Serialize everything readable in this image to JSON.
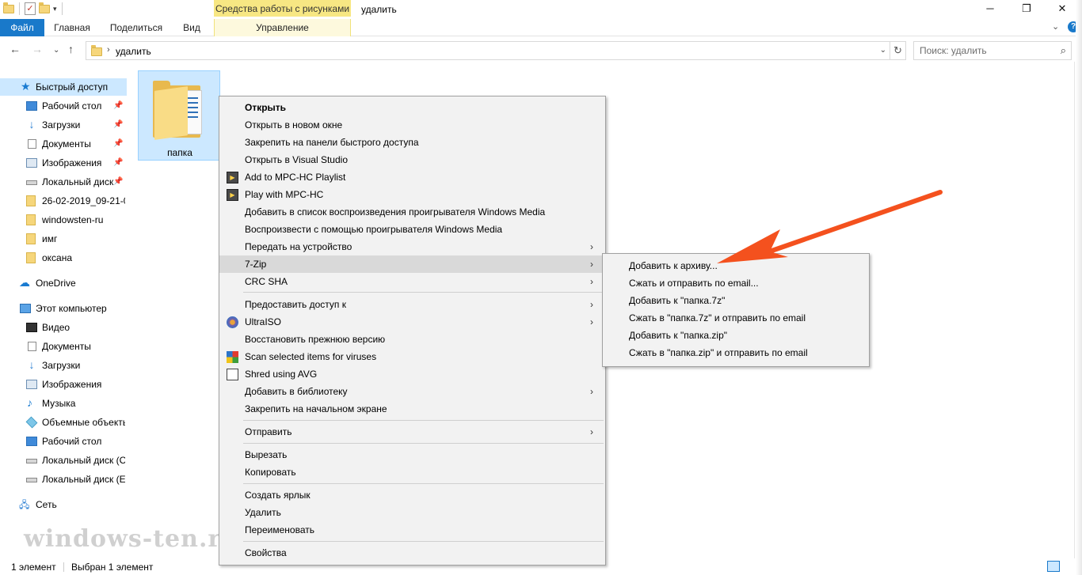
{
  "titlebar": {
    "context_tab_group": "Средства работы с рисунками",
    "title": "удалить",
    "minimize": "─",
    "maximize": "❐",
    "close": "✕"
  },
  "ribbon": {
    "tabs": [
      "Файл",
      "Главная",
      "Поделиться",
      "Вид",
      "Управление"
    ],
    "collapse": "⌄",
    "help": "?"
  },
  "address": {
    "path": "удалить",
    "search_placeholder": "Поиск: удалить"
  },
  "sidebar": {
    "quick_access": "Быстрый доступ",
    "quick_items": [
      {
        "label": "Рабочий стол",
        "pinned": true
      },
      {
        "label": "Загрузки",
        "pinned": true
      },
      {
        "label": "Документы",
        "pinned": true
      },
      {
        "label": "Изображения",
        "pinned": true
      },
      {
        "label": "Локальный диск",
        "pinned": true
      },
      {
        "label": "26-02-2019_09-21-0",
        "pinned": false
      },
      {
        "label": "windowsten-ru",
        "pinned": false
      },
      {
        "label": "имг",
        "pinned": false
      },
      {
        "label": "оксана",
        "pinned": false
      }
    ],
    "onedrive": "OneDrive",
    "this_pc": "Этот компьютер",
    "pc_items": [
      "Видео",
      "Документы",
      "Загрузки",
      "Изображения",
      "Музыка",
      "Объемные объекты",
      "Рабочий стол",
      "Локальный диск (C",
      "Локальный диск (E"
    ],
    "network": "Сеть"
  },
  "content": {
    "folder_name": "папка"
  },
  "context_menu": {
    "items": [
      {
        "label": "Открыть",
        "bold": true
      },
      {
        "label": "Открыть в новом окне"
      },
      {
        "label": "Закрепить на панели быстрого доступа"
      },
      {
        "label": "Открыть в Visual Studio"
      },
      {
        "label": "Add to MPC-HC Playlist",
        "icon": "mpc-icon"
      },
      {
        "label": "Play with MPC-HC",
        "icon": "mpc-icon"
      },
      {
        "label": "Добавить в список воспроизведения проигрывателя Windows Media"
      },
      {
        "label": "Воспроизвести с помощью проигрывателя Windows Media"
      },
      {
        "label": "Передать на устройство",
        "submenu": true
      },
      {
        "label": "7-Zip",
        "submenu": true,
        "highlighted": true
      },
      {
        "label": "CRC SHA",
        "submenu": true
      },
      {
        "label": "Предоставить доступ к",
        "submenu": true
      },
      {
        "label": "UltraISO",
        "submenu": true,
        "icon": "ultraiso-icon"
      },
      {
        "label": "Восстановить прежнюю версию"
      },
      {
        "label": "Scan selected items for viruses",
        "icon": "avg-icon"
      },
      {
        "label": "Shred using AVG",
        "icon": "shredder-icon"
      },
      {
        "label": "Добавить в библиотеку",
        "submenu": true
      },
      {
        "label": "Закрепить на начальном экране"
      },
      {
        "label": "Отправить",
        "submenu": true
      },
      {
        "label": "Вырезать"
      },
      {
        "label": "Копировать"
      },
      {
        "label": "Создать ярлык"
      },
      {
        "label": "Удалить"
      },
      {
        "label": "Переименовать"
      },
      {
        "label": "Свойства"
      }
    ]
  },
  "submenu_7zip": {
    "items": [
      "Добавить к архиву...",
      "Сжать и отправить по email...",
      "Добавить к \"папка.7z\"",
      "Сжать в \"папка.7z\" и отправить по email",
      "Добавить к \"папка.zip\"",
      "Сжать в \"папка.zip\" и отправить по email"
    ]
  },
  "statusbar": {
    "count": "1 элемент",
    "selected": "Выбран 1 элемент"
  },
  "watermark": "windows-ten.ru",
  "colors": {
    "file_tab": "#1979ca",
    "selection": "#cce8ff",
    "context_tab": "#f7e783",
    "arrow": "#f4511e"
  }
}
